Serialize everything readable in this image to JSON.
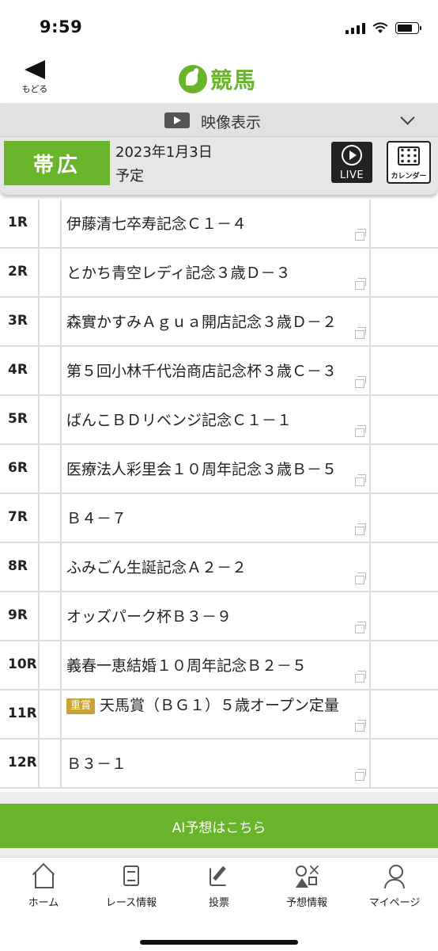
{
  "status_bar": {
    "time": "9:59",
    "battery_level": 0.8
  },
  "header": {
    "back_label": "もどる",
    "logo_text": "競馬"
  },
  "video_bar": {
    "label": "映像表示"
  },
  "venue": {
    "name": "帯広",
    "date": "2023年1月3日",
    "status": "予定"
  },
  "buttons": {
    "live": "LIVE",
    "calendar": "カレンダー",
    "ai": "AI予想はこちら"
  },
  "races": [
    {
      "no": "1R",
      "name": "伊藤清七卒寿記念Ｃ１－４",
      "grade": ""
    },
    {
      "no": "2R",
      "name": "とかち青空レディ記念３歳Ｄ－３",
      "grade": ""
    },
    {
      "no": "3R",
      "name": "森實かすみＡｇｕａ開店記念３歳Ｄ－２",
      "grade": ""
    },
    {
      "no": "4R",
      "name": "第５回小林千代治商店記念杯３歳Ｃ－３",
      "grade": ""
    },
    {
      "no": "5R",
      "name": "ばんこＢＤリベンジ記念Ｃ１－１",
      "grade": ""
    },
    {
      "no": "6R",
      "name": "医療法人彩里会１０周年記念３歳Ｂ－５",
      "grade": ""
    },
    {
      "no": "7R",
      "name": "Ｂ４－７",
      "grade": ""
    },
    {
      "no": "8R",
      "name": "ふみごん生誕記念Ａ２－２",
      "grade": ""
    },
    {
      "no": "9R",
      "name": "オッズパーク杯Ｂ３－９",
      "grade": ""
    },
    {
      "no": "10R",
      "name": "義春一恵結婚１０周年記念Ｂ２－５",
      "grade": ""
    },
    {
      "no": "11R",
      "name": "天馬賞（ＢＧ１）５歳オープン定量",
      "grade": "重賞"
    },
    {
      "no": "12R",
      "name": "Ｂ３－１",
      "grade": ""
    }
  ],
  "tabbar": {
    "home": "ホーム",
    "race_info": "レース情報",
    "vote": "投票",
    "prediction": "予想情報",
    "mypage": "マイページ"
  },
  "colors": {
    "accent_green": "#6ab42c",
    "grade_gold": "#c6a337"
  }
}
